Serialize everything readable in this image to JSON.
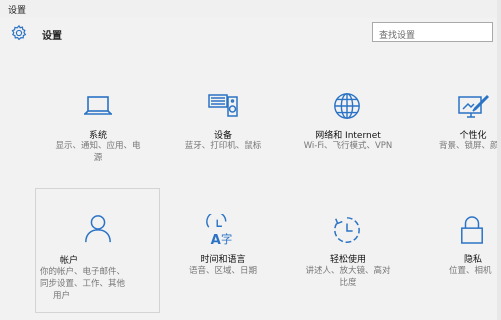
{
  "window": {
    "title": "设置"
  },
  "header": {
    "title": "设置",
    "icon": "gear-icon"
  },
  "search": {
    "placeholder": "查找设置"
  },
  "accent": "#2a73c5",
  "tiles": [
    {
      "label": "系统",
      "desc_lines": [
        "显示、通知、应用、电",
        "源"
      ],
      "icon": "laptop-icon"
    },
    {
      "label": "设备",
      "desc_lines": [
        "蓝牙、打印机、鼠标"
      ],
      "icon": "devices-icon"
    },
    {
      "label": "网络和 Internet",
      "desc_lines": [
        "Wi-Fi、飞行模式、VPN"
      ],
      "icon": "globe-icon"
    },
    {
      "label": "个性化",
      "desc_lines": [
        "背景、锁屏、颜"
      ],
      "icon": "personalization-icon"
    },
    {
      "label": "帐户",
      "desc_lines": [
        "你的帐户、电子邮件、",
        "同步设置、工作、其他",
        "用户"
      ],
      "icon": "person-icon"
    },
    {
      "label": "时间和语言",
      "desc_lines": [
        "语音、区域、日期"
      ],
      "icon": "time-language-icon"
    },
    {
      "label": "轻松使用",
      "desc_lines": [
        "讲述人、放大镜、高对",
        "比度"
      ],
      "icon": "ease-of-access-icon"
    },
    {
      "label": "隐私",
      "desc_lines": [
        "位置、相机"
      ],
      "icon": "lock-icon"
    }
  ]
}
